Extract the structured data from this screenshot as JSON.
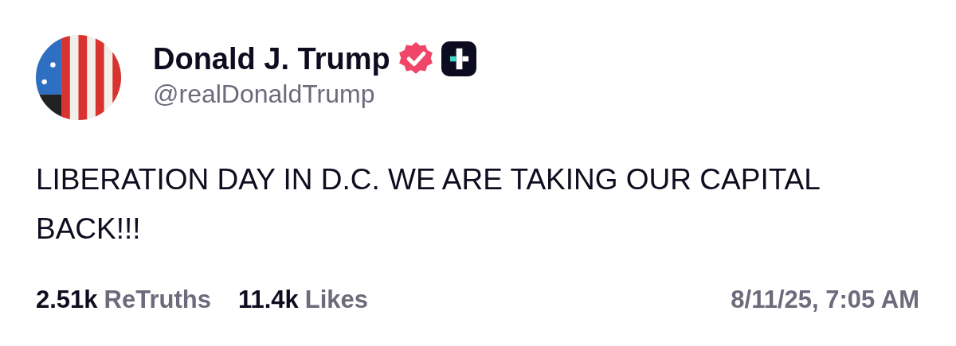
{
  "author": {
    "name": "Donald J. Trump",
    "verified": true,
    "plus_badge": true,
    "handle": "@realDonaldTrump"
  },
  "post": {
    "text": "LIBERATION DAY IN D.C. WE ARE TAKING OUR CAPITAL BACK!!!"
  },
  "stats": [
    {
      "count": "2.51k",
      "label": "ReTruths"
    },
    {
      "count": "11.4k",
      "label": "Likes"
    }
  ],
  "timestamp": "8/11/25, 7:05 AM"
}
